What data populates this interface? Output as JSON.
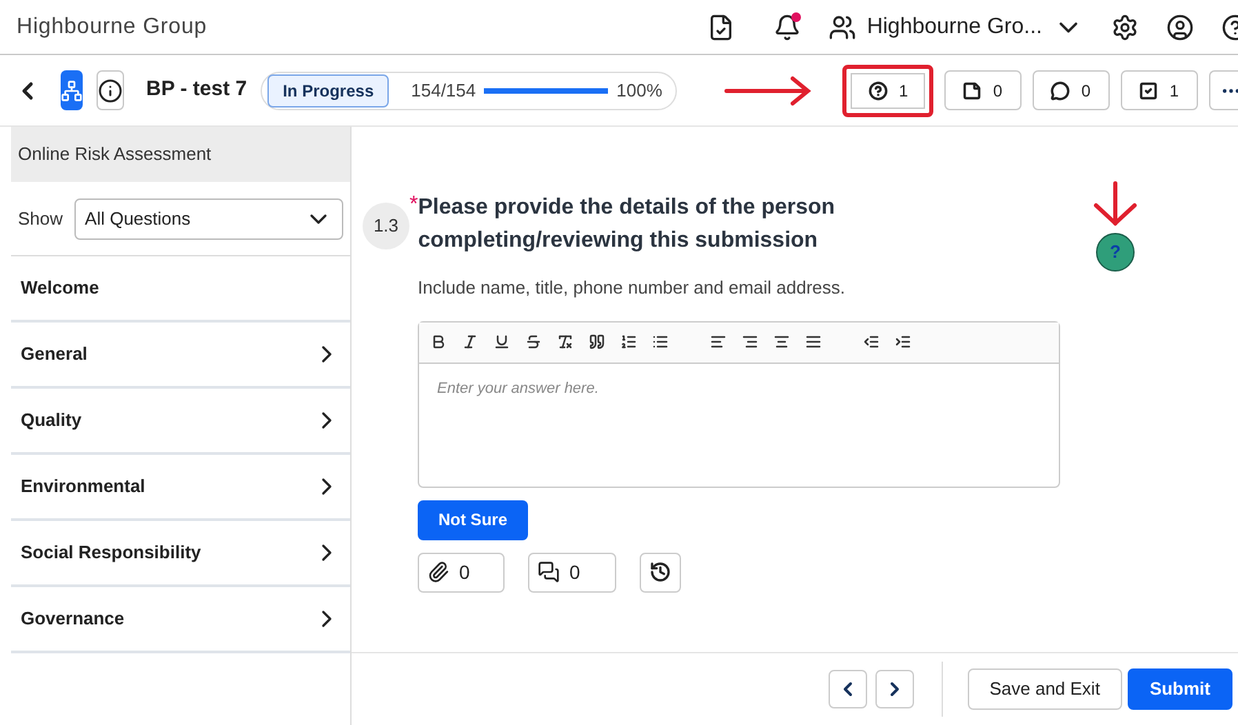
{
  "header": {
    "brand": "Highbourne Group",
    "notification_unread": true,
    "account": "Highbourne Gro..."
  },
  "toolbar": {
    "title": "BP - test 7",
    "status": "In Progress",
    "progress_count": "154/154",
    "progress": {
      "level": 1.0
    },
    "percent": "100%",
    "counters": [
      {
        "kind": "question",
        "count": "1",
        "highlighted": true
      },
      {
        "kind": "note",
        "count": "0",
        "highlighted": false
      },
      {
        "kind": "comment",
        "count": "0",
        "highlighted": false
      },
      {
        "kind": "task",
        "count": "1",
        "highlighted": false
      }
    ]
  },
  "sidebar": {
    "title": "Online Risk Assessment",
    "show_label": "Show",
    "filter": "All Questions",
    "items": [
      {
        "label": "Welcome",
        "kind": "page"
      },
      {
        "label": "General",
        "kind": "section"
      },
      {
        "label": "Quality",
        "kind": "section"
      },
      {
        "label": "Environmental",
        "kind": "section"
      },
      {
        "label": "Social Responsibility",
        "kind": "section"
      },
      {
        "label": "Governance",
        "kind": "section"
      }
    ]
  },
  "question": {
    "number": "1.3",
    "required_mark": "*",
    "text": "Please provide the details of the person completing/reviewing this submission",
    "hint": "Include name, title, phone number and email address.",
    "answer": {
      "placeholder": "Enter your answer here."
    },
    "help_badge": "?",
    "not_sure": "Not Sure",
    "attachments": "0",
    "comments": "0"
  },
  "footer": {
    "buttons": [
      "Save and Exit",
      "Submit"
    ]
  }
}
